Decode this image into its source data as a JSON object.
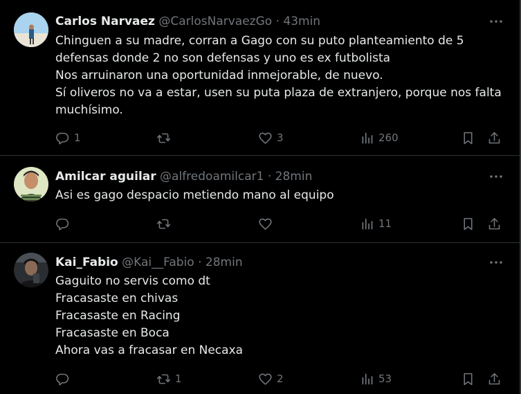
{
  "tweets": [
    {
      "name": "Carlos Narvaez",
      "handle": "@CarlosNarvaezGo",
      "separator": "·",
      "time": "43min",
      "lines": [
        "Chinguen a su madre, corran a Gago con su puto planteamiento de 5",
        "defensas donde 2 no son defensas y uno es ex futbolista",
        "Nos arruinaron una oportunidad inmejorable, de nuevo.",
        "Sí oliveros no va a estar, usen su puta plaza de extranjero, porque nos falta",
        "muchísimo."
      ],
      "replies": "1",
      "retweets": "",
      "likes": "3",
      "views": "260",
      "icons": [
        "more-icon",
        "reply-icon",
        "retweet-icon",
        "like-icon",
        "views-icon",
        "bookmark-icon",
        "share-icon"
      ]
    },
    {
      "name": "Amilcar aguilar",
      "handle": "@alfredoamilcar1",
      "separator": "·",
      "time": "28min",
      "lines": [
        "Asi es gago despacio metiendo mano al equipo"
      ],
      "replies": "",
      "retweets": "",
      "likes": "",
      "views": "11",
      "icons": [
        "more-icon",
        "reply-icon",
        "retweet-icon",
        "like-icon",
        "views-icon",
        "bookmark-icon",
        "share-icon"
      ]
    },
    {
      "name": "Kai_Fabio",
      "handle": "@Kai__Fabio",
      "separator": "·",
      "time": "28min",
      "lines": [
        "Gaguito no servis como dt",
        "Fracasaste en chivas",
        "Fracasaste en Racing",
        "Fracasaste en Boca",
        "Ahora vas a fracasar en Necaxa"
      ],
      "replies": "",
      "retweets": "1",
      "likes": "2",
      "views": "53",
      "icons": [
        "more-icon",
        "reply-icon",
        "retweet-icon",
        "like-icon",
        "views-icon",
        "bookmark-icon",
        "share-icon"
      ]
    }
  ],
  "colors": {
    "background": "#000000",
    "text_primary": "#e7e9ea",
    "text_secondary": "#71767b",
    "divider": "#2f3336"
  }
}
